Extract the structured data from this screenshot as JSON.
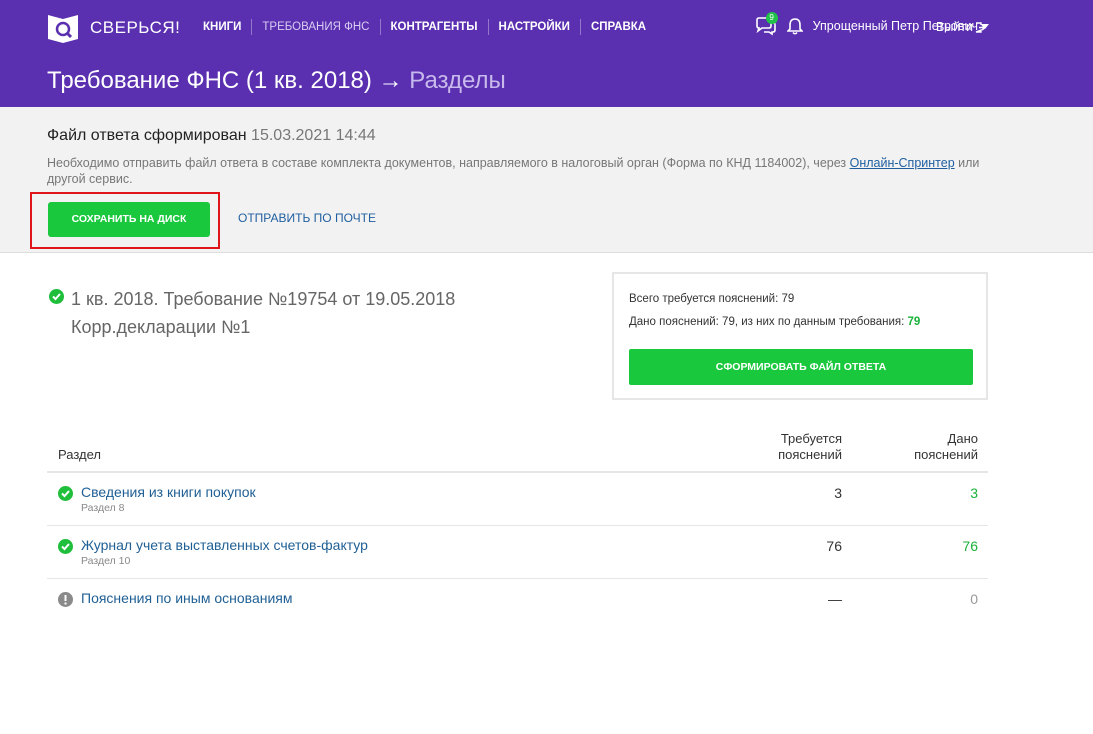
{
  "header": {
    "logo_text": "СВЕРЬСЯ!",
    "nav": [
      "КНИГИ",
      "ТРЕБОВАНИЯ ФНС",
      "КОНТРАГЕНТЫ",
      "НАСТРОЙКИ",
      "СПРАВКА"
    ],
    "active_nav": "ТРЕБОВАНИЯ ФНС",
    "chat_badge": "9",
    "user_name": "Упрощенный Петр Петрович",
    "logout": "Выйти",
    "title_main": "Требование ФНС (1 кв. 2018)",
    "title_arrow": " → ",
    "title_sub": "Разделы"
  },
  "notice": {
    "title": "Файл ответа сформирован",
    "time": "15.03.2021 14:44",
    "text_before": "Необходимо отправить файл ответа в составе комплекта документов, направляемого в налоговый орган (Форма по КНД 1184002), через ",
    "link": "Онлайн-Спринтер",
    "text_after": " или другой сервис.",
    "save_button": "СОХРАНИТЬ НА ДИСК",
    "mail_button": "ОТПРАВИТЬ ПО ПОЧТЕ"
  },
  "requirement": {
    "line1": "1 кв. 2018. Требование №19754 от 19.05.2018",
    "line2": "Корр.декларации №1"
  },
  "summary": {
    "total_label": "Всего требуется пояснений: 79",
    "given_label": "Дано пояснений: 79, из них по данным требования: ",
    "given_value": "79",
    "generate_button": "СФОРМИРОВАТЬ ФАЙЛ ОТВЕТА"
  },
  "table": {
    "col_section": "Раздел",
    "col_required_1": "Требуется",
    "col_required_2": "пояснений",
    "col_given_1": "Дано",
    "col_given_2": "пояснений",
    "rows": [
      {
        "title": "Сведения из книги покупок",
        "sub": "Раздел 8",
        "required": "3",
        "given": "3"
      },
      {
        "title": "Журнал учета выставленных счетов-фактур",
        "sub": "Раздел 10",
        "required": "76",
        "given": "76"
      },
      {
        "title": "Пояснения по иным основаниям",
        "sub": "",
        "required": "—",
        "given": "0"
      }
    ]
  },
  "colors": {
    "header_bg": "#5a2fb0",
    "accent_green": "#19c83c",
    "link_blue": "#1f5f94",
    "highlight_red": "#e0141b"
  }
}
